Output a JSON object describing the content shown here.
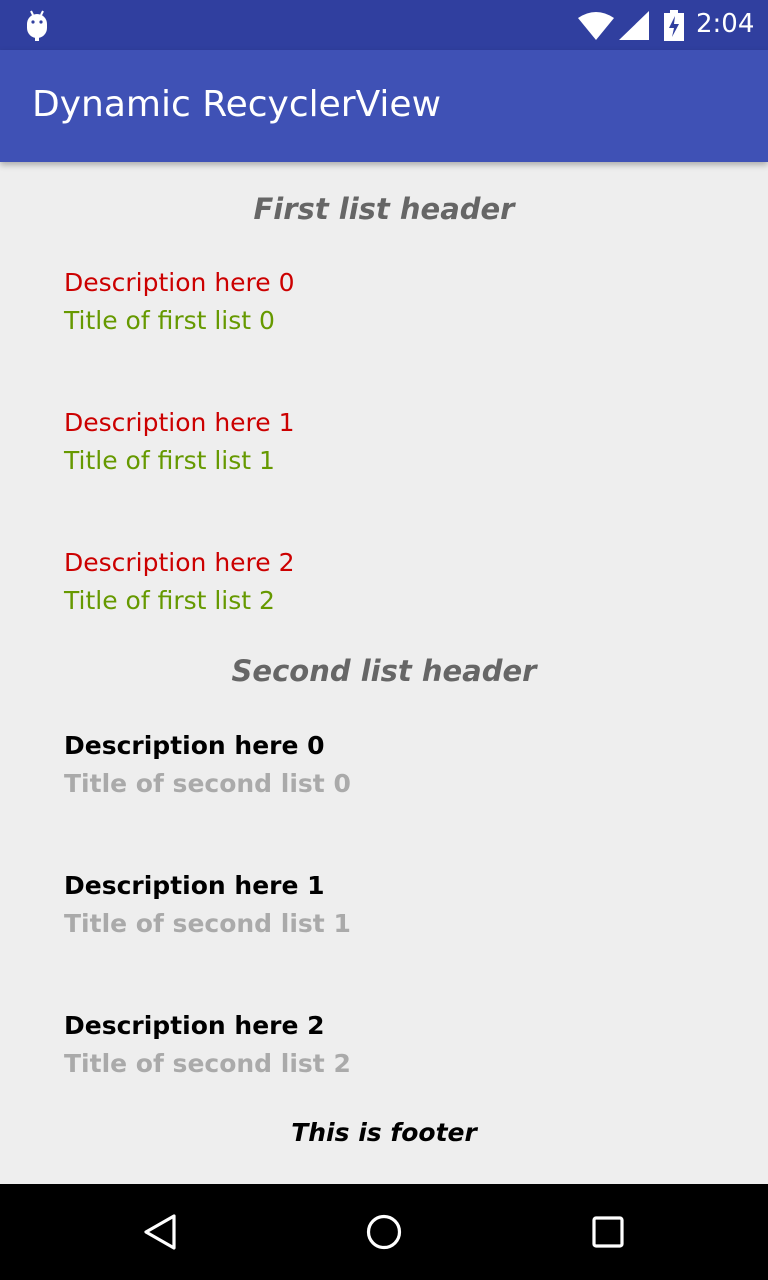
{
  "status_bar": {
    "time": "2:04",
    "icons": [
      "android-debug-icon",
      "wifi-icon",
      "signal-icon",
      "battery-charging-icon"
    ]
  },
  "app_bar": {
    "title": "Dynamic RecyclerView",
    "color": "#3f51b5",
    "status_color": "#303f9f"
  },
  "first_list": {
    "header": "First list header",
    "items": [
      {
        "description": "Description here 0",
        "title": "Title of first list 0"
      },
      {
        "description": "Description here 1",
        "title": "Title of first list 1"
      },
      {
        "description": "Description here 2",
        "title": "Title of first list 2"
      }
    ]
  },
  "second_list": {
    "header": "Second list header",
    "items": [
      {
        "description": "Description here 0",
        "title": "Title of second list 0"
      },
      {
        "description": "Description here 1",
        "title": "Title of second list 1"
      },
      {
        "description": "Description here 2",
        "title": "Title of second list 2"
      }
    ]
  },
  "footer": "This is footer",
  "colors": {
    "first_description": "#cc0000",
    "first_title": "#669900",
    "second_description": "#000000",
    "second_title": "#aaaaaa",
    "header_text": "#666666"
  },
  "nav_bar": {
    "buttons": [
      "back-icon",
      "home-icon",
      "recents-icon"
    ]
  }
}
